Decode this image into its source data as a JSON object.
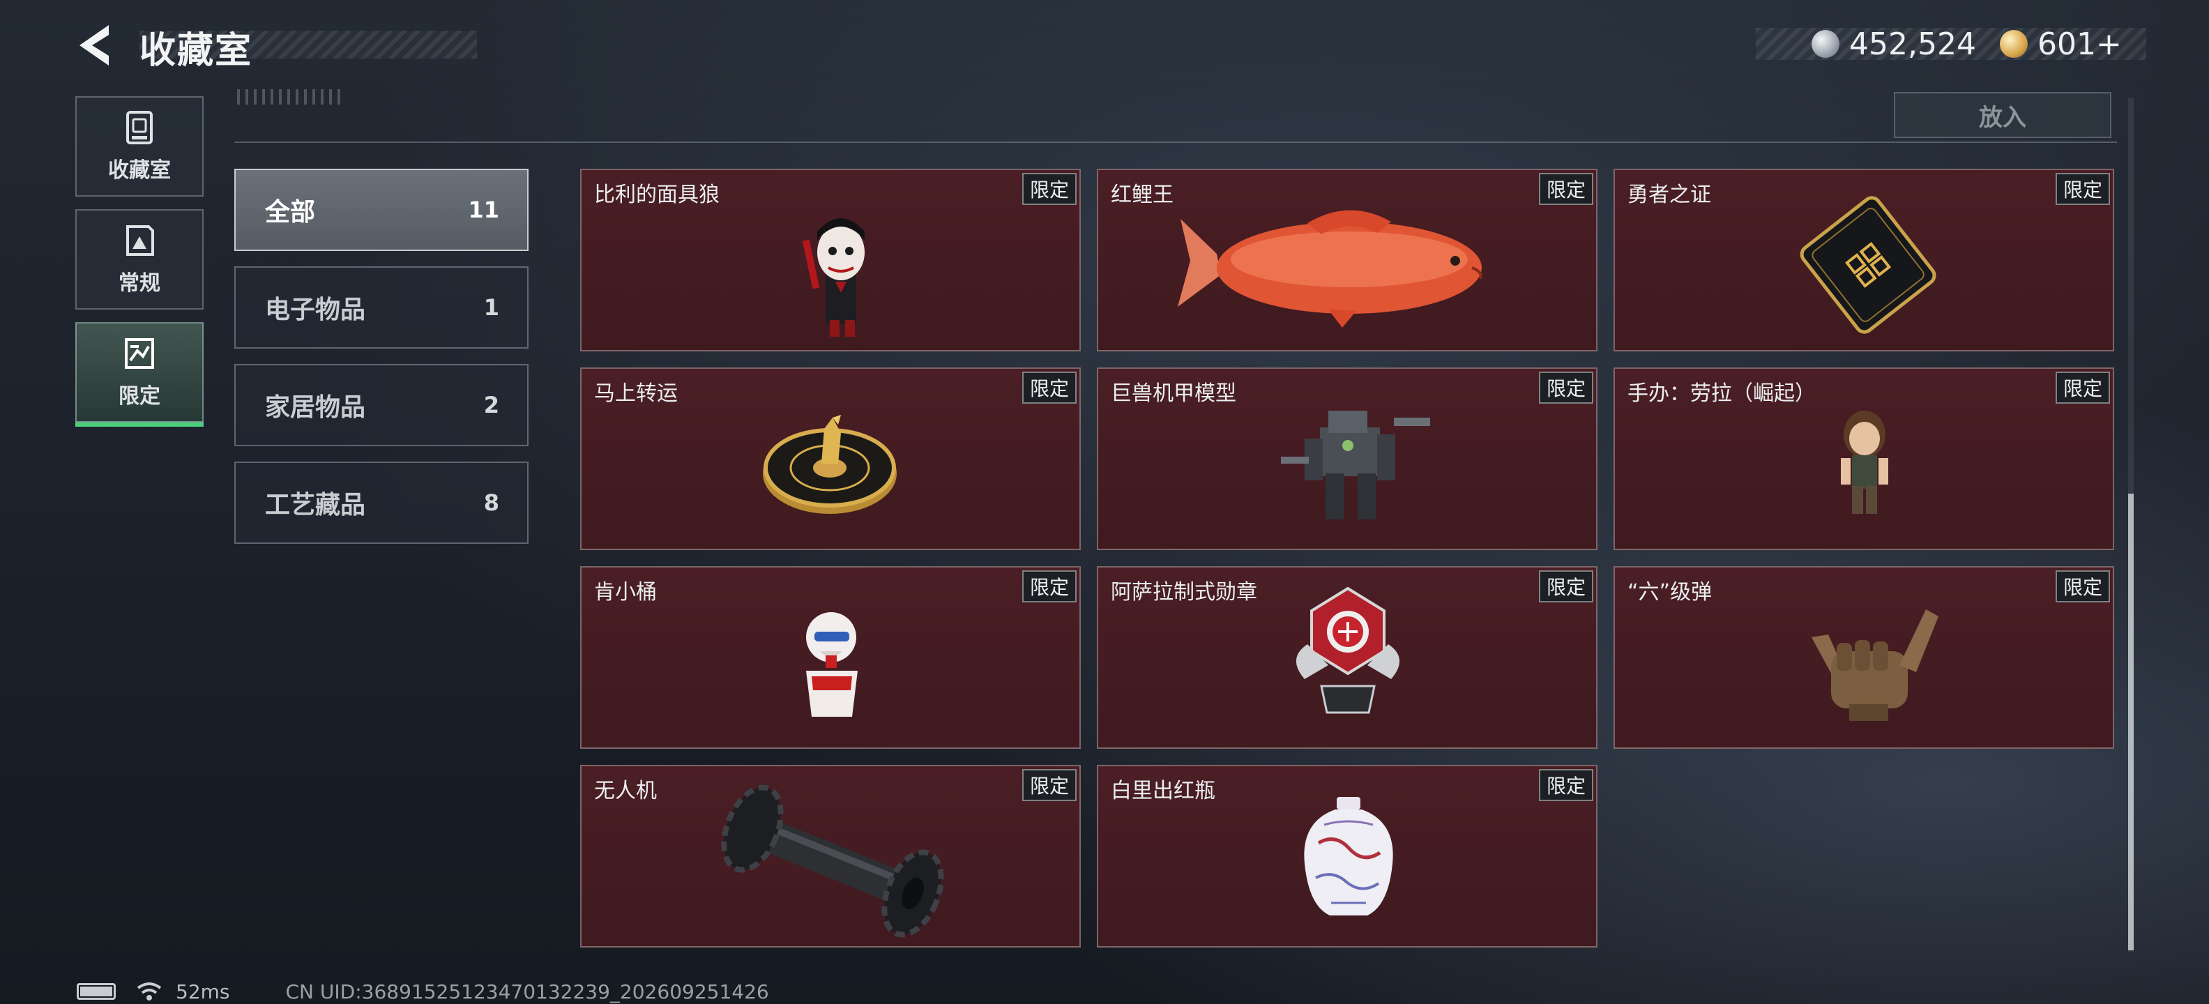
{
  "header": {
    "title": "收藏室",
    "back_icon": "back-arrow-icon",
    "currencies": [
      {
        "icon": "silver-coin-icon",
        "value": "452,524"
      },
      {
        "icon": "gold-coin-icon",
        "value": "601+"
      }
    ]
  },
  "rail": [
    {
      "label": "收藏室",
      "icon": "collection-icon",
      "active": false
    },
    {
      "label": "常规",
      "icon": "regular-icon",
      "active": false
    },
    {
      "label": "限定",
      "icon": "limited-icon",
      "active": true
    }
  ],
  "place_button": "放入",
  "categories": [
    {
      "label": "全部",
      "count": "11",
      "active": true
    },
    {
      "label": "电子物品",
      "count": "1",
      "active": false
    },
    {
      "label": "家居物品",
      "count": "2",
      "active": false
    },
    {
      "label": "工艺藏品",
      "count": "8",
      "active": false
    }
  ],
  "items": [
    {
      "name": "比利的面具狼",
      "tag": "限定",
      "icon": "puppet-figure-icon"
    },
    {
      "name": "红鲤王",
      "tag": "限定",
      "icon": "red-carp-icon"
    },
    {
      "name": "勇者之证",
      "tag": "限定",
      "icon": "black-card-icon"
    },
    {
      "name": "马上转运",
      "tag": "限定",
      "icon": "horse-dial-icon"
    },
    {
      "name": "巨兽机甲模型",
      "tag": "限定",
      "icon": "mech-model-icon"
    },
    {
      "name": "手办：劳拉（崛起）",
      "tag": "限定",
      "icon": "lara-figure-icon"
    },
    {
      "name": "肯小桶",
      "tag": "限定",
      "icon": "bucket-figure-icon"
    },
    {
      "name": "阿萨拉制式勋章",
      "tag": "限定",
      "icon": "medal-icon"
    },
    {
      "name": "“六”级弹",
      "tag": "限定",
      "icon": "bronze-hand-icon"
    },
    {
      "name": "无人机",
      "tag": "限定",
      "icon": "drone-roller-icon"
    },
    {
      "name": "白里出红瓶",
      "tag": "限定",
      "icon": "porcelain-vase-icon"
    }
  ],
  "status": {
    "ping": "52ms",
    "uid": "CN UID:36891525123470132239_202609251426"
  },
  "colors": {
    "card_bg": "#471d23",
    "active_tab_bar": "#49d17c"
  }
}
